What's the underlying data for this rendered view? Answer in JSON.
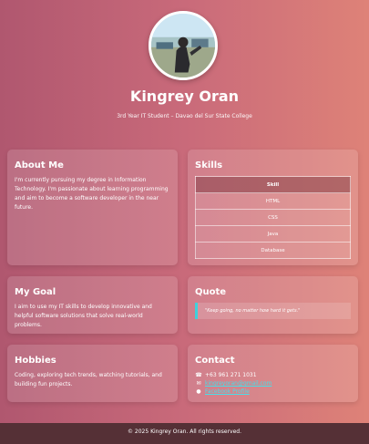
{
  "profile": {
    "name": "Kingrey Oran",
    "subtitle": "3rd Year IT Student – Davao del Sur State College"
  },
  "about": {
    "title": "About Me",
    "text": "I'm currently pursuing my degree in Information Technology. I'm passionate about learning programming and aim to become a software developer in the near future."
  },
  "skills": {
    "title": "Skills",
    "header": "Skill",
    "items": [
      "HTML",
      "CSS",
      "Java",
      "Database"
    ]
  },
  "goal": {
    "title": "My Goal",
    "text": "I aim to use my IT skills to develop innovative and helpful software solutions that solve real-world problems."
  },
  "quote": {
    "title": "Quote",
    "text": "\"Keep going, no matter how hard it gets.\""
  },
  "hobbies": {
    "title": "Hobbies",
    "text": "Coding, exploring tech trends, watching tutorials, and building fun projects."
  },
  "contact": {
    "title": "Contact",
    "phone": "+63 961 271 1031",
    "email": "kingreyoran@gmail.com",
    "facebook": "Facebook Profile",
    "icons": [
      "phone-icon",
      "email-icon",
      "facebook-icon"
    ]
  },
  "footer": {
    "text": "© 2025 Kingrey Oran. All rights reserved."
  },
  "colors": {
    "accent": "#45e0ea",
    "footer_bg": "#553036",
    "bg_start": "#b0576f",
    "bg_end": "#de8278"
  }
}
